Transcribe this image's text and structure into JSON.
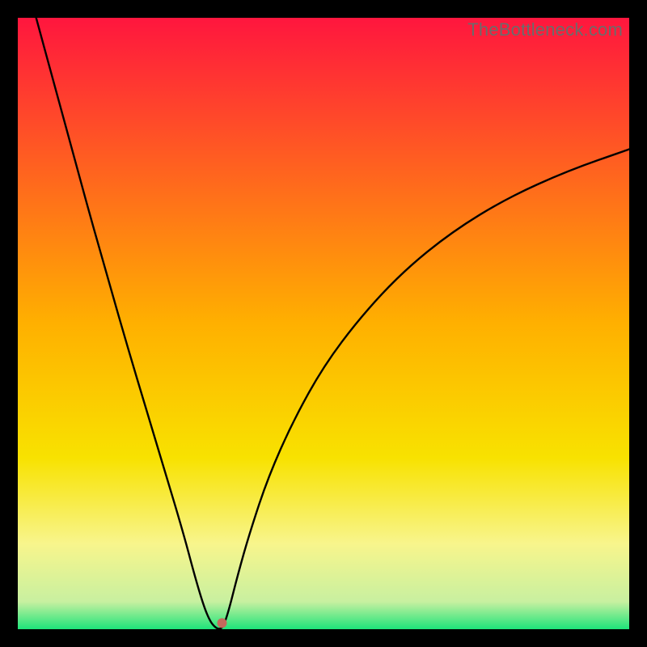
{
  "watermark": "TheBottleneck.com",
  "chart_data": {
    "type": "line",
    "title": "",
    "xlabel": "",
    "ylabel": "",
    "xlim": [
      0,
      100
    ],
    "ylim": [
      0,
      100
    ],
    "grid": false,
    "legend": false,
    "background_gradient": {
      "stops": [
        {
          "pos": 0.0,
          "color": "#ff163e"
        },
        {
          "pos": 0.5,
          "color": "#ffb000"
        },
        {
          "pos": 0.72,
          "color": "#f8e200"
        },
        {
          "pos": 0.86,
          "color": "#f8f58c"
        },
        {
          "pos": 0.955,
          "color": "#c8f0a0"
        },
        {
          "pos": 1.0,
          "color": "#1ee47a"
        }
      ]
    },
    "series": [
      {
        "name": "bottleneck-curve",
        "x": [
          3,
          6,
          9,
          12,
          15,
          18,
          21,
          24,
          27,
          29,
          30.5,
          31.5,
          32.4,
          33,
          33.6,
          34.5,
          36,
          38,
          41,
          45,
          50,
          56,
          63,
          71,
          80,
          90,
          100
        ],
        "y": [
          100,
          89,
          78,
          67,
          56.5,
          46,
          36,
          26,
          16,
          8.5,
          3.5,
          1.2,
          0.2,
          0,
          0.4,
          3,
          9,
          16,
          25,
          34,
          43,
          51,
          58.5,
          65,
          70.5,
          75,
          78.5
        ]
      }
    ],
    "marker": {
      "x": 33.4,
      "y": 1.0,
      "color": "#c46a5c",
      "radius": 6
    }
  }
}
